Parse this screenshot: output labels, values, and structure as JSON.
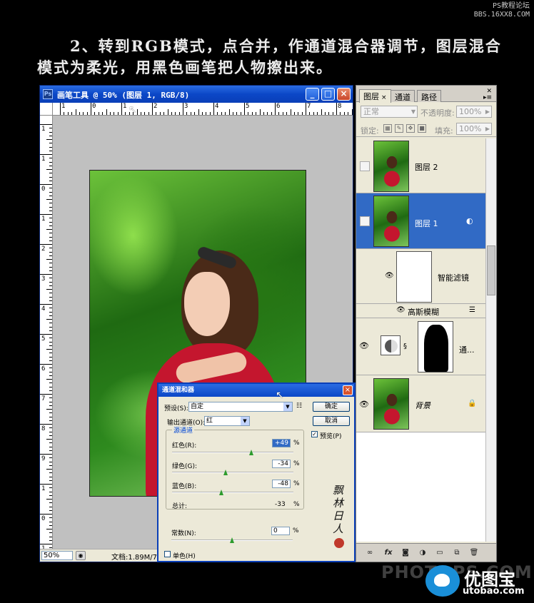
{
  "watermark_top": {
    "line1": "PS教程论坛",
    "line2": "BBS.16XX8.COM"
  },
  "heading": {
    "line1": "2、转到RGB模式，点合并，作通道混合器调节，图层混合",
    "line2": "模式为柔光，用黑色画笔把人物擦出来。"
  },
  "document": {
    "title": "画笔工具 @ 50% (图层 1, RGB/8)",
    "ruler_h": [
      "1",
      "0",
      "1",
      "2",
      "3",
      "4",
      "5",
      "6",
      "7",
      "8"
    ],
    "ruler_v": [
      "1",
      "1",
      "0",
      "1",
      "2",
      "3",
      "4",
      "5",
      "6",
      "7",
      "8",
      "9",
      "1",
      "0",
      "1"
    ],
    "zoom": "50%",
    "docinfo": "文档:1.89M/7"
  },
  "layers_panel": {
    "tabs": [
      "图层",
      "通道",
      "路径"
    ],
    "tab_close": "×",
    "blend_mode": "正常",
    "opacity_label": "不透明度:",
    "opacity_value": "100%",
    "lock_label": "锁定:",
    "fill_label": "填充:",
    "fill_value": "100%",
    "layers": [
      {
        "name": "图层 2",
        "visible": false,
        "selected": false
      },
      {
        "name": "图层 1",
        "visible": false,
        "selected": true
      },
      {
        "name": "智能滤镜",
        "visible": true,
        "selected": false
      },
      {
        "name": "高斯模糊",
        "visible": true,
        "selected": false
      },
      {
        "name": "通...",
        "visible": true,
        "selected": false
      },
      {
        "name": "背景",
        "visible": true,
        "selected": false
      }
    ],
    "bottom_icons": [
      "link-icon",
      "fx-icon",
      "mask-icon",
      "adjustment-icon",
      "folder-icon",
      "new-layer-icon",
      "trash-icon"
    ]
  },
  "dialog": {
    "title": "通道混和器",
    "close": "×",
    "preset_label": "预设(S):",
    "preset_value": "自定",
    "output_label": "输出通道(O):",
    "output_value": "红",
    "ok_label": "确定",
    "cancel_label": "取消",
    "preview_label": "预览(P)",
    "preview_checked": true,
    "source_group": "源通道",
    "red_label": "红色(R):",
    "red_value": "+49",
    "green_label": "绿色(G):",
    "green_value": "-34",
    "blue_label": "蓝色(B):",
    "blue_value": "-48",
    "total_label": "总计:",
    "total_value": "-33",
    "constant_label": "常数(N):",
    "constant_value": "0",
    "mono_label": "单色(H)",
    "percent": "%",
    "signature": "飘 林 日 人",
    "sliders": {
      "red": 49,
      "green": -34,
      "blue": -48,
      "constant": 0
    }
  },
  "watermark_bottom": {
    "photo": "PHOTOPS.COM",
    "brand": "优图宝",
    "url": "utobao.com"
  }
}
